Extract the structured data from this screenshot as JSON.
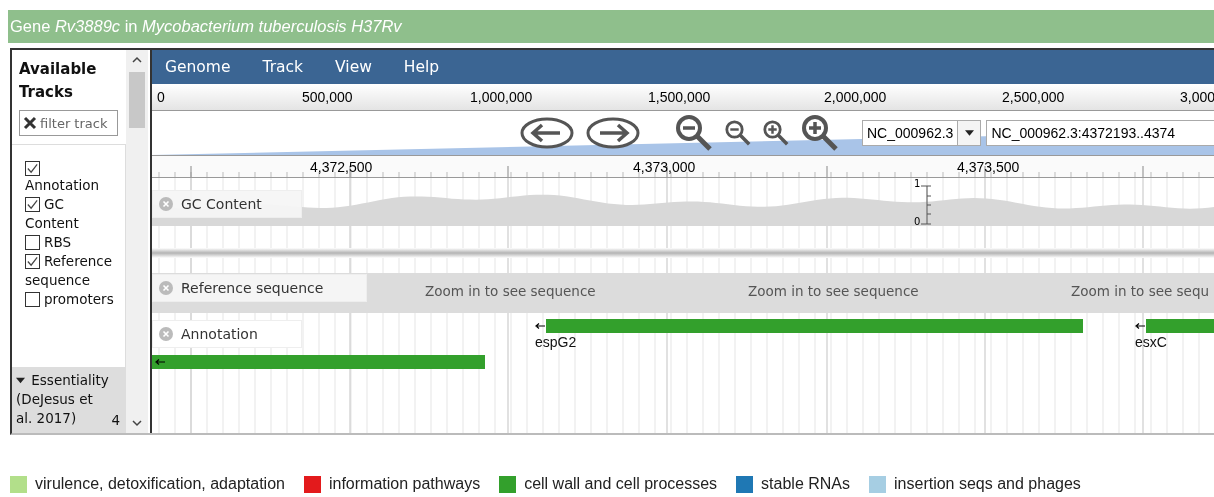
{
  "title": "Gene *Rv3889c* in *Mycobacterium tuberculosis H37Rv*",
  "sidebar": {
    "heading": "Available Tracks",
    "filter": {
      "placeholder": "filter track"
    },
    "tracks": [
      {
        "label": "Annotation",
        "checked": true
      },
      {
        "label": "GC Content",
        "checked": true
      },
      {
        "label": "RBS",
        "checked": false
      },
      {
        "label": "Reference sequence",
        "checked": true
      },
      {
        "label": "promoters",
        "checked": false
      }
    ],
    "category": {
      "label": "Essentiality (DeJesus et al. 2017)",
      "count": "4",
      "expanded": true
    }
  },
  "menu": [
    {
      "label": "Genome"
    },
    {
      "label": "Track"
    },
    {
      "label": "View"
    },
    {
      "label": "Help"
    }
  ],
  "overview_ruler": [
    "0",
    "500,000",
    "1,000,000",
    "1,500,000",
    "2,000,000",
    "2,500,000",
    "3,000"
  ],
  "navigation": {
    "reference": "NC_000962.3",
    "location": "NC_000962.3:4372193..4374"
  },
  "detail_ruler": [
    "4,372,500",
    "4,373,000",
    "4,373,500"
  ],
  "tracks": [
    {
      "kind": "wiggle",
      "label": "GC Content",
      "scale_max": "1",
      "scale_min": "0"
    },
    {
      "kind": "sequence",
      "label": "Reference sequence",
      "messages": [
        "Zoom in to see sequence",
        "Zoom in to see sequence",
        "Zoom in to see sequ"
      ]
    },
    {
      "kind": "features",
      "label": "Annotation",
      "features": [
        {
          "name": "espG2",
          "reverse": true,
          "color": "#33a02c"
        },
        {
          "name": "esxC",
          "reverse": true,
          "color": "#33a02c"
        },
        {
          "reverse": true,
          "color": "#33a02c"
        }
      ]
    }
  ],
  "legend": [
    {
      "label": "virulence, detoxification, adaptation",
      "color": "#b2df8a"
    },
    {
      "label": "information pathways",
      "color": "#e31a1c"
    },
    {
      "label": "cell wall and cell processes",
      "color": "#33a02c"
    },
    {
      "label": "stable RNAs",
      "color": "#1f78b4"
    },
    {
      "label": "insertion seqs and phages",
      "color": "#a6cee3"
    }
  ]
}
